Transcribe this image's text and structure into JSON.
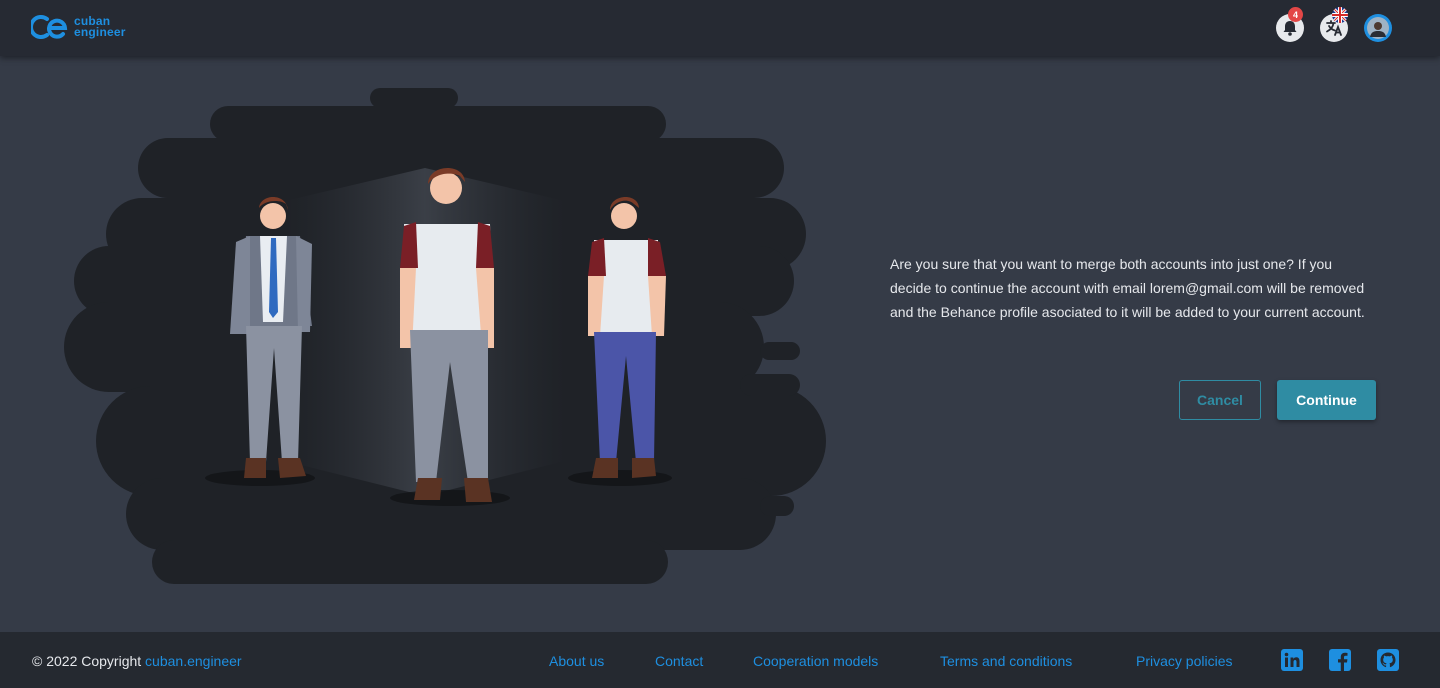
{
  "header": {
    "logo_line1": "cuban",
    "logo_line2": "engineer",
    "notification_count": "4",
    "icons": [
      "logo-icon",
      "bell-icon",
      "translate-icon",
      "uk-flag-icon",
      "avatar"
    ]
  },
  "dialog": {
    "message": "Are you sure that you want to merge both accounts into just one? If you decide to continue the account with email lorem@gmail.com will be removed and the Behance profile asociated to it will be added to your current account.",
    "cancel_label": "Cancel",
    "continue_label": "Continue"
  },
  "footer": {
    "copyright_prefix": "© 2022 Copyright",
    "copyright_brand": "cuban.engineer",
    "links": [
      "About us",
      "Contact",
      "Cooperation models",
      "Terms and conditions",
      "Privacy policies"
    ],
    "social": [
      "linkedin-icon",
      "facebook-icon",
      "github-icon"
    ]
  },
  "colors": {
    "background": "#353b47",
    "topbar": "#262a33",
    "footer": "#252930",
    "accent": "#1e8fe0",
    "button": "#2f8ca3",
    "badge": "#e34747"
  }
}
